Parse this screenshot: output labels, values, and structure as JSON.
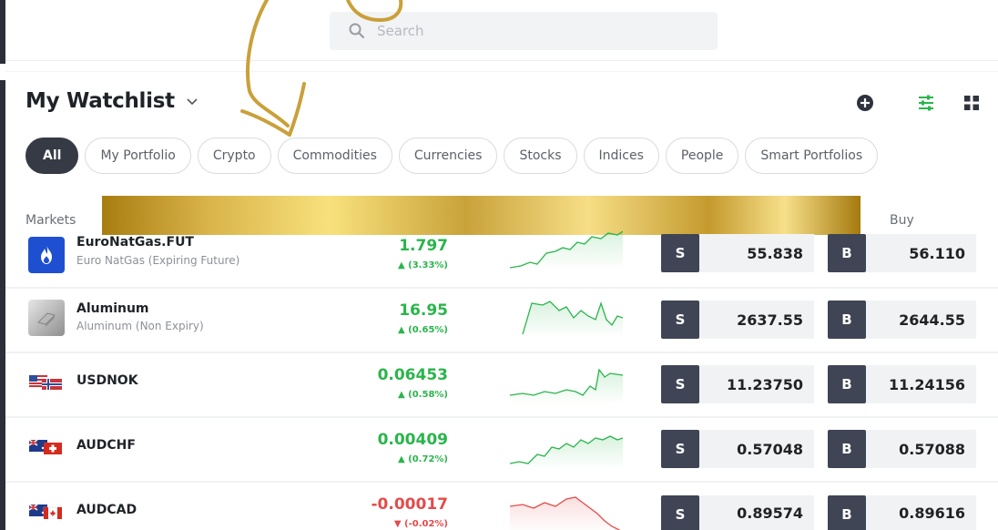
{
  "search": {
    "placeholder": "Search"
  },
  "header": {
    "title": "My Watchlist"
  },
  "filters": [
    {
      "label": "All",
      "active": true
    },
    {
      "label": "My Portfolio"
    },
    {
      "label": "Crypto"
    },
    {
      "label": "Commodities"
    },
    {
      "label": "Currencies"
    },
    {
      "label": "Stocks"
    },
    {
      "label": "Indices"
    },
    {
      "label": "People"
    },
    {
      "label": "Smart Portfolios"
    }
  ],
  "columns": {
    "markets": "Markets",
    "buy": "Buy"
  },
  "rows": [
    {
      "name": "EuroNatGas.FUT",
      "sub": "Euro NatGas (Expiring Future)",
      "price": "1.797",
      "change": "▲ (3.33%)",
      "trend": "up",
      "sell_label": "S",
      "sell": "55.838",
      "buy_label": "B",
      "buy": "56.110",
      "icon": "flame-icon"
    },
    {
      "name": "Aluminum",
      "sub": "Aluminum (Non Expiry)",
      "price": "16.95",
      "change": "▲ (0.65%)",
      "trend": "up",
      "sell_label": "S",
      "sell": "2637.55",
      "buy_label": "B",
      "buy": "2644.55",
      "icon": "aluminum-icon"
    },
    {
      "name": "USDNOK",
      "sub": "",
      "price": "0.06453",
      "change": "▲ (0.58%)",
      "trend": "up",
      "sell_label": "S",
      "sell": "11.23750",
      "buy_label": "B",
      "buy": "11.24156",
      "icon": "usd-nok-flags-icon"
    },
    {
      "name": "AUDCHF",
      "sub": "",
      "price": "0.00409",
      "change": "▲ (0.72%)",
      "trend": "up",
      "sell_label": "S",
      "sell": "0.57048",
      "buy_label": "B",
      "buy": "0.57088",
      "icon": "aud-chf-flags-icon"
    },
    {
      "name": "AUDCAD",
      "sub": "",
      "price": "-0.00017",
      "change": "▼ (-0.02%)",
      "trend": "down",
      "sell_label": "S",
      "sell": "0.89574",
      "buy_label": "B",
      "buy": "0.89616",
      "icon": "aud-cad-flags-icon"
    }
  ],
  "colors": {
    "positive": "#2ab54b",
    "negative": "#e44b4b",
    "button": "#3f4555",
    "gold": "#d4a93a"
  }
}
